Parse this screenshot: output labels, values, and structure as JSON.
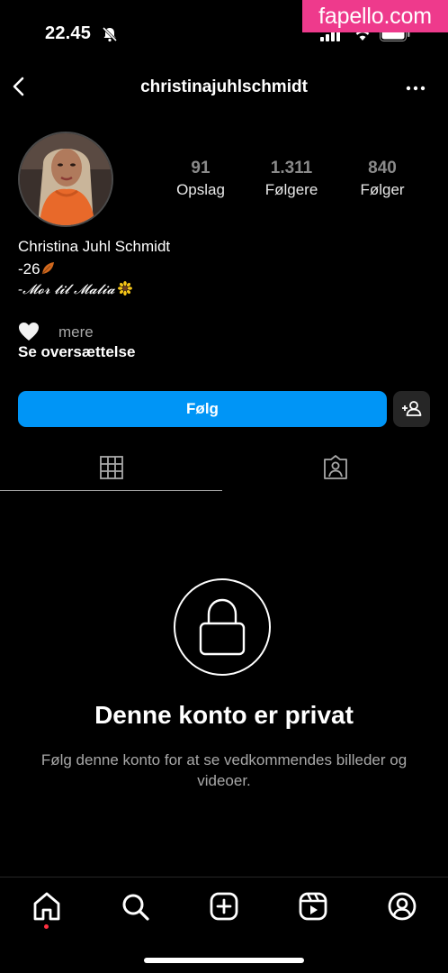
{
  "status_bar": {
    "time": "22.45",
    "icons": [
      "bell-muted-icon",
      "signal-icon",
      "wifi-icon",
      "battery-icon"
    ]
  },
  "watermark": "fapello.com",
  "header": {
    "username": "christinajuhlschmidt",
    "icons": [
      "back-icon",
      "more-icon"
    ]
  },
  "profile": {
    "stats": [
      {
        "value": "91",
        "label": "Opslag"
      },
      {
        "value": "1.311",
        "label": "Følgere"
      },
      {
        "value": "840",
        "label": "Følger"
      }
    ],
    "bio": {
      "name": "Christina Juhl Schmidt",
      "line1": "-26",
      "line2": "-𝓜𝓸𝓻 𝓽𝓲𝓵 𝓜𝓪𝓵𝓲𝓪",
      "more": "mere",
      "translate": "Se oversættelse"
    }
  },
  "actions": {
    "follow_label": "Følg"
  },
  "tabs": [
    "grid-icon",
    "tagged-icon"
  ],
  "private": {
    "title": "Denne konto er privat",
    "description": "Følg denne konto for at se vedkommendes billeder og videoer."
  },
  "bottom_nav": [
    "home-icon",
    "search-icon",
    "create-icon",
    "reels-icon",
    "profile-icon"
  ],
  "colors": {
    "background": "#000000",
    "accent": "#0095f6",
    "secondary_button": "#262626",
    "watermark": "#ee3a8c",
    "notification_dot": "#ff3040"
  }
}
